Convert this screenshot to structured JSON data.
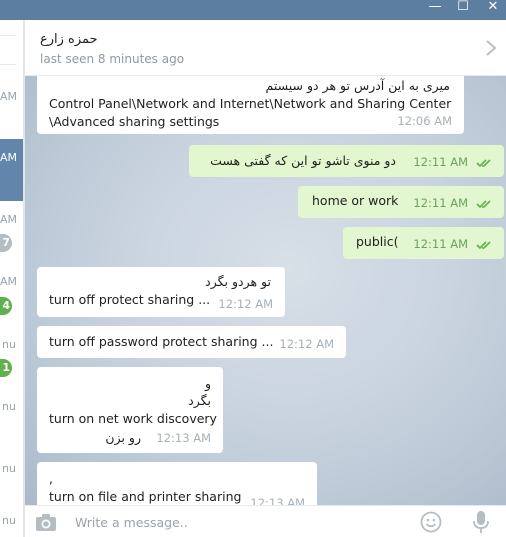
{
  "window": {
    "minimize": "—",
    "maximize": "☐",
    "close": "✕"
  },
  "sidebar": {
    "labels": [
      "AM",
      "AM",
      "AM",
      "AM",
      "nu",
      "nu",
      "nu",
      "nu"
    ],
    "badges": [
      "7",
      "4",
      "1"
    ]
  },
  "header": {
    "contact_name": "حمزه زارع",
    "last_seen": "last seen 8 minutes ago"
  },
  "messages": [
    {
      "dir": "in",
      "lines": [
        "میری به این آدرس تو هر دو سیستم",
        "Control Panel\\Network and Internet\\Network and Sharing Center",
        "\\Advanced sharing settings"
      ],
      "time": "12:06 AM"
    },
    {
      "dir": "out",
      "lines": [
        "دو منوی تاشو تو این که گفتی هست"
      ],
      "time": "12:11 AM"
    },
    {
      "dir": "out",
      "lines": [
        "home or work"
      ],
      "time": "12:11 AM"
    },
    {
      "dir": "out",
      "lines": [
        "public("
      ],
      "time": "12:11 AM"
    },
    {
      "dir": "in",
      "lines": [
        "تو هردو بگرد",
        "turn off protect sharing ..."
      ],
      "time": "12:12 AM"
    },
    {
      "dir": "in",
      "lines": [
        "turn off password protect sharing ..."
      ],
      "time": "12:12 AM"
    },
    {
      "dir": "in",
      "lines": [
        "و",
        "بگرد",
        "turn on net work discovery",
        "رو بزن"
      ],
      "time": "12:13 AM"
    },
    {
      "dir": "in",
      "lines": [
        ",",
        "turn on file and printer sharing"
      ],
      "time": "12:13 AM"
    }
  ],
  "compose": {
    "placeholder": "Write a message.."
  },
  "colors": {
    "header_bar": "#5c7fa0",
    "outgoing_bubble": "#e2f6cf",
    "incoming_bubble": "#ffffff",
    "read_ticks": "#5eb14c"
  }
}
